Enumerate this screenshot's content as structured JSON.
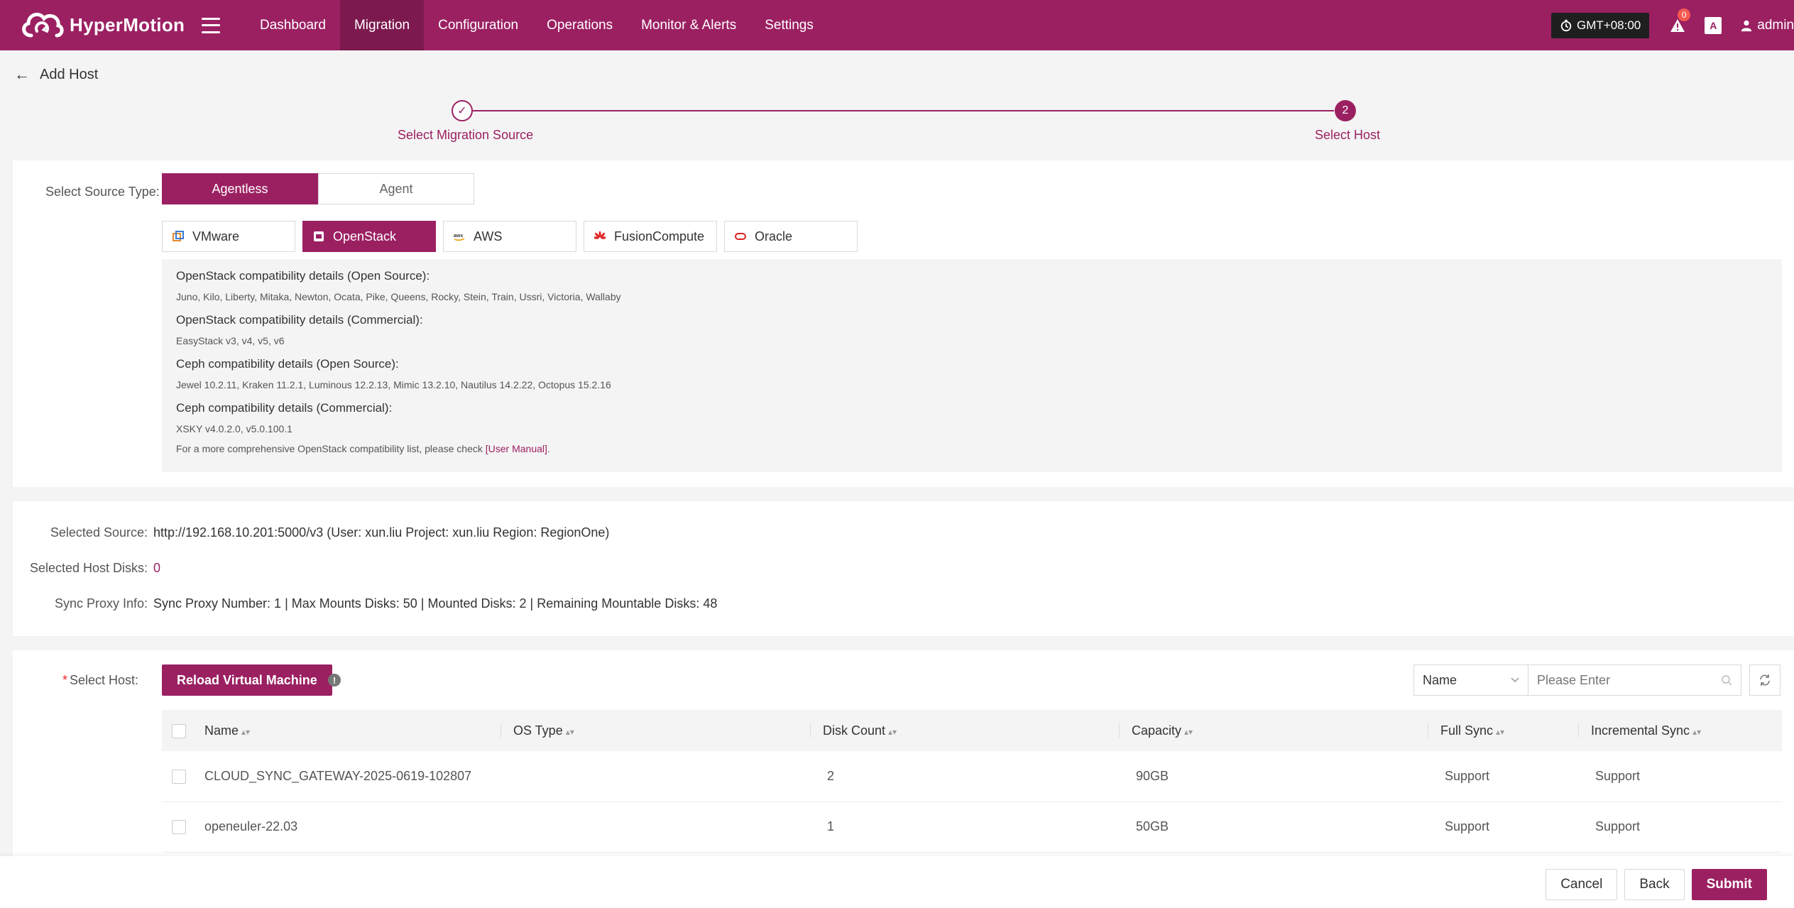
{
  "app": {
    "name": "HyperMotion",
    "nav": [
      "Dashboard",
      "Migration",
      "Configuration",
      "Operations",
      "Monitor & Alerts",
      "Settings"
    ],
    "active_nav": "Migration",
    "timezone": "GMT+08:00",
    "alert_count": "0",
    "lang_icon": "A",
    "user": "admin",
    "brand_color": "#9b2062"
  },
  "page": {
    "title": "Add Host",
    "back_icon": "arrow-left-icon"
  },
  "steps": [
    {
      "label": "Select Migration Source",
      "marker": "✓",
      "status": "done"
    },
    {
      "label": "Select Host",
      "marker": "2",
      "status": "current"
    }
  ],
  "source": {
    "label": "Select Source Type:",
    "types": [
      "Agentless",
      "Agent"
    ],
    "active_type": "Agentless",
    "platforms": [
      {
        "name": "VMware",
        "icon": "vmware-icon"
      },
      {
        "name": "OpenStack",
        "icon": "openstack-icon"
      },
      {
        "name": "AWS",
        "icon": "aws-icon"
      },
      {
        "name": "FusionCompute",
        "icon": "huawei-icon"
      },
      {
        "name": "Oracle",
        "icon": "oracle-icon"
      }
    ],
    "active_platform": "OpenStack"
  },
  "compat": {
    "items": [
      {
        "title": "OpenStack compatibility details (Open Source):",
        "text": "Juno, Kilo, Liberty, Mitaka, Newton, Ocata, Pike, Queens, Rocky, Stein, Train, Ussri, Victoria, Wallaby"
      },
      {
        "title": "OpenStack compatibility details (Commercial):",
        "text": "EasyStack v3, v4, v5, v6"
      },
      {
        "title": "Ceph compatibility details (Open Source):",
        "text": "Jewel 10.2.11, Kraken 11.2.1, Luminous 12.2.13, Mimic 13.2.10, Nautilus 14.2.22, Octopus 15.2.16"
      },
      {
        "title": "Ceph compatibility details (Commercial):",
        "text": "XSKY v4.0.2.0, v5.0.100.1"
      }
    ],
    "footer_prefix": "For a more comprehensive OpenStack compatibility list, please check ",
    "footer_link": "[User Manual]",
    "footer_suffix": "."
  },
  "summary": {
    "selected_source_label": "Selected Source:",
    "selected_source_value": "http://192.168.10.201:5000/v3 (User: xun.liu Project: xun.liu Region: RegionOne)",
    "selected_disks_label": "Selected Host Disks:",
    "selected_disks_value": "0",
    "sync_proxy_label": "Sync Proxy Info:",
    "sync_proxy_value": "Sync Proxy Number: 1 | Max Mounts Disks: 50 | Mounted Disks: 2 | Remaining Mountable Disks: 48"
  },
  "hosts": {
    "required_mark": "*",
    "label": "Select Host:",
    "reload_label": "Reload Virtual Machine",
    "info_mark": "!",
    "filter_field": "Name",
    "search_placeholder": "Please Enter",
    "columns": [
      "Name",
      "OS Type",
      "Disk Count",
      "Capacity",
      "Full Sync",
      "Incremental Sync"
    ],
    "rows": [
      {
        "name": "CLOUD_SYNC_GATEWAY-2025-0619-102807",
        "os": "",
        "disks": "2",
        "capacity": "90GB",
        "full": "Support",
        "incr": "Support"
      },
      {
        "name": "openeuler-22.03",
        "os": "",
        "disks": "1",
        "capacity": "50GB",
        "full": "Support",
        "incr": "Support"
      }
    ]
  },
  "footer": {
    "cancel": "Cancel",
    "back": "Back",
    "submit": "Submit"
  }
}
